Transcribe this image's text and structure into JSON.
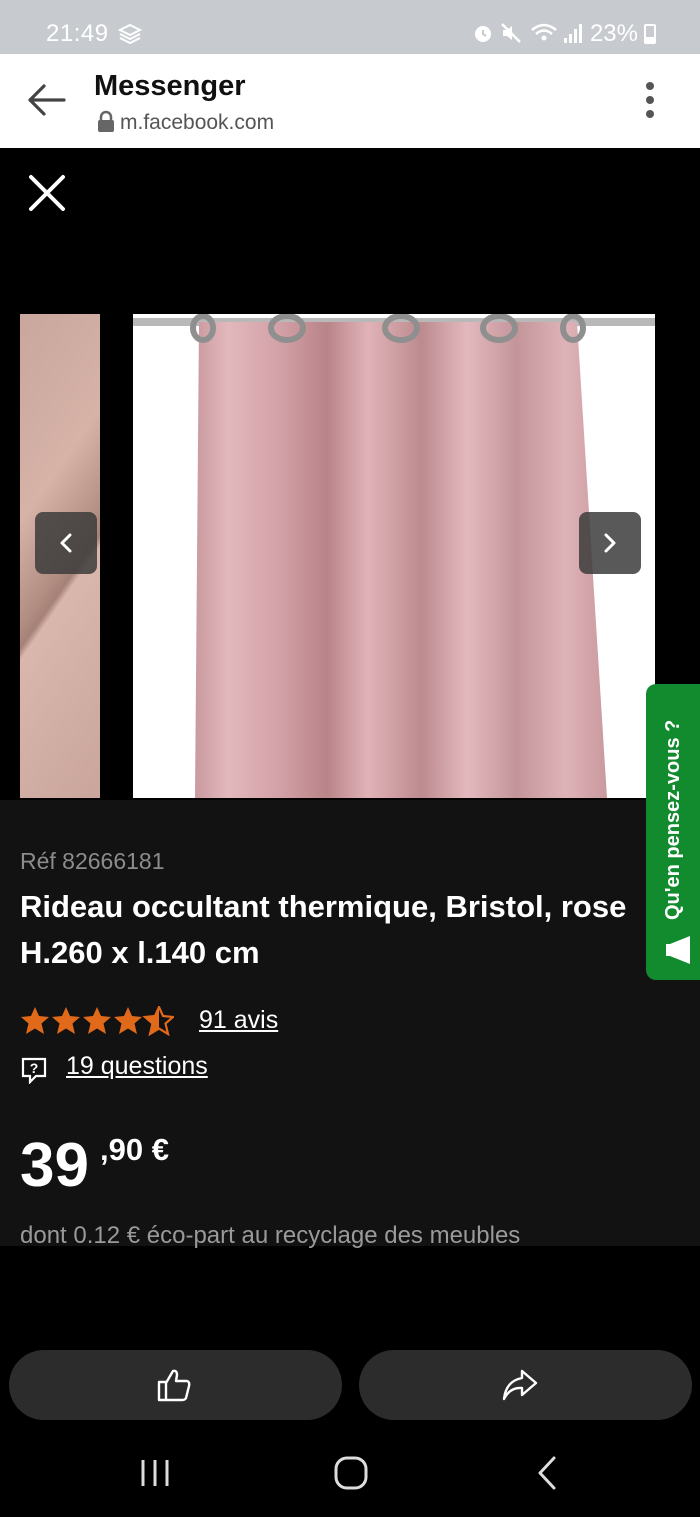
{
  "status_bar": {
    "time": "21:49",
    "battery": "23%"
  },
  "browser": {
    "title": "Messenger",
    "url": "m.facebook.com"
  },
  "product": {
    "ref": "Réf 82666181",
    "title": "Rideau occultant thermique, Bristol, rose H.260 x l.140 cm",
    "rating": 4.5,
    "reviews": "91 avis",
    "questions": "19 questions",
    "price_int": "39",
    "price_dec": ",90 €",
    "eco": "dont 0.12 € éco-part au recyclage des meubles"
  },
  "feedback_tab": "Qu'en pensez-vous ?",
  "icons": [
    "stack-icon",
    "alarm-icon",
    "mute-icon",
    "wifi-icon",
    "signal-icon",
    "battery-icon",
    "back-arrow-icon",
    "lock-icon",
    "more-icon",
    "close-icon",
    "prev-arrow-icon",
    "next-arrow-icon",
    "star-icon",
    "question-icon",
    "megaphone-icon",
    "like-icon",
    "share-icon",
    "recent-apps-icon",
    "home-icon",
    "nav-back-icon"
  ],
  "colors": {
    "accent_green": "#128a2e",
    "star": "#e0691a",
    "curtain": "#d6a8ae"
  }
}
